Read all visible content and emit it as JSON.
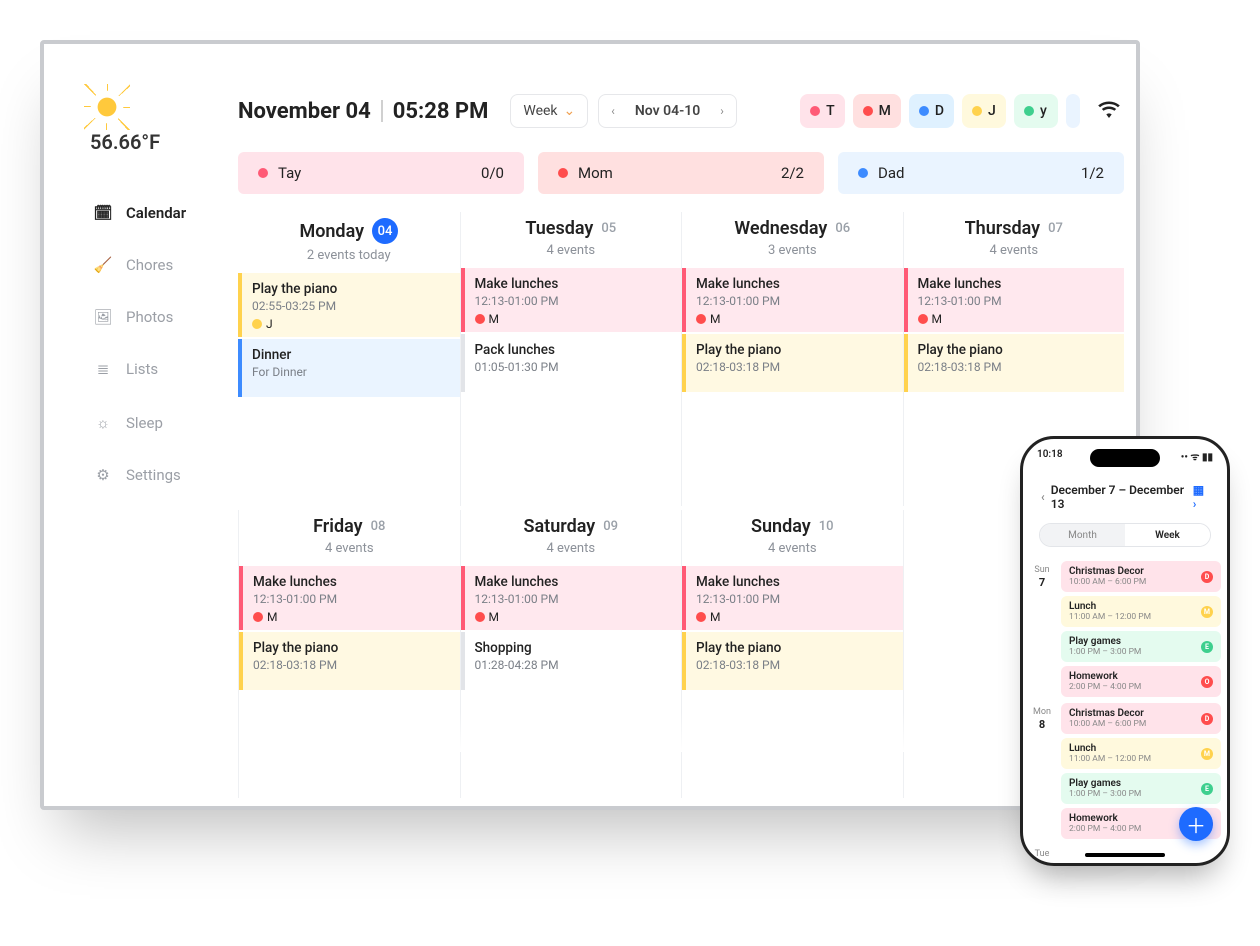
{
  "weather": {
    "temp": "56.66°F"
  },
  "header": {
    "date": "November 04",
    "time": "05:28 PM",
    "view_label": "Week",
    "range_label": "Nov 04-10"
  },
  "people": [
    {
      "key": "T",
      "label": "T",
      "bg": "bg-pink",
      "dot": "c-pink"
    },
    {
      "key": "M",
      "label": "M",
      "bg": "bg-red",
      "dot": "c-red"
    },
    {
      "key": "D",
      "label": "D",
      "bg": "bg-blue",
      "dot": "c-blue"
    },
    {
      "key": "J",
      "label": "J",
      "bg": "bg-yellow",
      "dot": "c-yellow"
    },
    {
      "key": "y",
      "label": "y",
      "bg": "bg-green",
      "dot": "c-green"
    }
  ],
  "nav": {
    "calendar": "Calendar",
    "chores": "Chores",
    "photos": "Photos",
    "lists": "Lists",
    "sleep": "Sleep",
    "settings": "Settings"
  },
  "chores": [
    {
      "name": "Tay",
      "count": "0/0",
      "bg": "bg-pink",
      "dot": "c-pink"
    },
    {
      "name": "Mom",
      "count": "2/2",
      "bg": "bg-red",
      "dot": "c-red"
    },
    {
      "name": "Dad",
      "count": "1/2",
      "bg": "bg-lblue",
      "dot": "c-blue"
    }
  ],
  "days_row1": [
    {
      "name": "Monday",
      "num": "04",
      "today": true,
      "sub": "2 events today",
      "events": [
        {
          "style": "yellow",
          "title": "Play the piano",
          "time": "02:55-03:25 PM",
          "who": "J",
          "who_dot": "c-yellow"
        },
        {
          "style": "blue",
          "title": "Dinner",
          "time": "For Dinner"
        }
      ]
    },
    {
      "name": "Tuesday",
      "num": "05",
      "today": false,
      "sub": "4 events",
      "events": [
        {
          "style": "pink",
          "title": "Make lunches",
          "time": "12:13-01:00 PM",
          "who": "M",
          "who_dot": "c-red"
        },
        {
          "style": "plain",
          "title": "Pack lunches",
          "time": "01:05-01:30 PM"
        }
      ]
    },
    {
      "name": "Wednesday",
      "num": "06",
      "today": false,
      "sub": "3 events",
      "events": [
        {
          "style": "pink",
          "title": "Make lunches",
          "time": "12:13-01:00 PM",
          "who": "M",
          "who_dot": "c-red"
        },
        {
          "style": "yellow",
          "title": "Play the piano",
          "time": "02:18-03:18 PM"
        }
      ]
    },
    {
      "name": "Thursday",
      "num": "07",
      "today": false,
      "sub": "4 events",
      "events": [
        {
          "style": "pink",
          "title": "Make lunches",
          "time": "12:13-01:00 PM",
          "who": "M",
          "who_dot": "c-red"
        },
        {
          "style": "yellow",
          "title": "Play the piano",
          "time": "02:18-03:18 PM"
        }
      ]
    }
  ],
  "days_row2": [
    {
      "name": "Friday",
      "num": "08",
      "today": false,
      "sub": "4 events",
      "events": [
        {
          "style": "pink",
          "title": "Make lunches",
          "time": "12:13-01:00 PM",
          "who": "M",
          "who_dot": "c-red"
        },
        {
          "style": "yellow",
          "title": "Play the piano",
          "time": "02:18-03:18 PM"
        }
      ]
    },
    {
      "name": "Saturday",
      "num": "09",
      "today": false,
      "sub": "4 events",
      "events": [
        {
          "style": "pink",
          "title": "Make lunches",
          "time": "12:13-01:00 PM",
          "who": "M",
          "who_dot": "c-red"
        },
        {
          "style": "plain",
          "title": "Shopping",
          "time": "01:28-04:28 PM"
        }
      ]
    },
    {
      "name": "Sunday",
      "num": "10",
      "today": false,
      "sub": "4 events",
      "events": [
        {
          "style": "pink",
          "title": "Make lunches",
          "time": "12:13-01:00 PM",
          "who": "M",
          "who_dot": "c-red"
        },
        {
          "style": "yellow",
          "title": "Play the piano",
          "time": "02:18-03:18 PM"
        }
      ]
    },
    {
      "name": "",
      "num": "",
      "today": false,
      "sub": "",
      "events": []
    }
  ],
  "phone": {
    "status_time": "10:18",
    "title": "December 7 – December 13",
    "seg_month": "Month",
    "seg_week": "Week",
    "days": [
      {
        "dow": "Sun",
        "num": "7",
        "items": [
          {
            "bg": "bg-pink",
            "tag": "c-red",
            "tagText": "D",
            "t": "Christmas Decor",
            "tm": "10:00 AM – 6:00 PM"
          },
          {
            "bg": "bg-yellow",
            "tag": "c-yellow",
            "tagText": "M",
            "t": "Lunch",
            "tm": "11:00 AM – 12:00 PM"
          },
          {
            "bg": "bg-green",
            "tag": "c-green",
            "tagText": "E",
            "t": "Play games",
            "tm": "1:00 PM – 3:00 PM"
          },
          {
            "bg": "bg-pink",
            "tag": "c-red",
            "tagText": "O",
            "t": "Homework",
            "tm": "2:00 PM – 4:00 PM"
          }
        ]
      },
      {
        "dow": "Mon",
        "num": "8",
        "items": [
          {
            "bg": "bg-pink",
            "tag": "c-red",
            "tagText": "D",
            "t": "Christmas Decor",
            "tm": "10:00 AM – 6:00 PM"
          },
          {
            "bg": "bg-yellow",
            "tag": "c-yellow",
            "tagText": "M",
            "t": "Lunch",
            "tm": "11:00 AM – 12:00 PM"
          },
          {
            "bg": "bg-green",
            "tag": "c-green",
            "tagText": "E",
            "t": "Play games",
            "tm": "1:00 PM – 3:00 PM"
          },
          {
            "bg": "bg-pink",
            "tag": "c-red",
            "tagText": "O",
            "t": "Homework",
            "tm": "2:00 PM – 4:00 PM"
          }
        ]
      },
      {
        "dow": "Tue",
        "num": "",
        "items": []
      }
    ]
  }
}
